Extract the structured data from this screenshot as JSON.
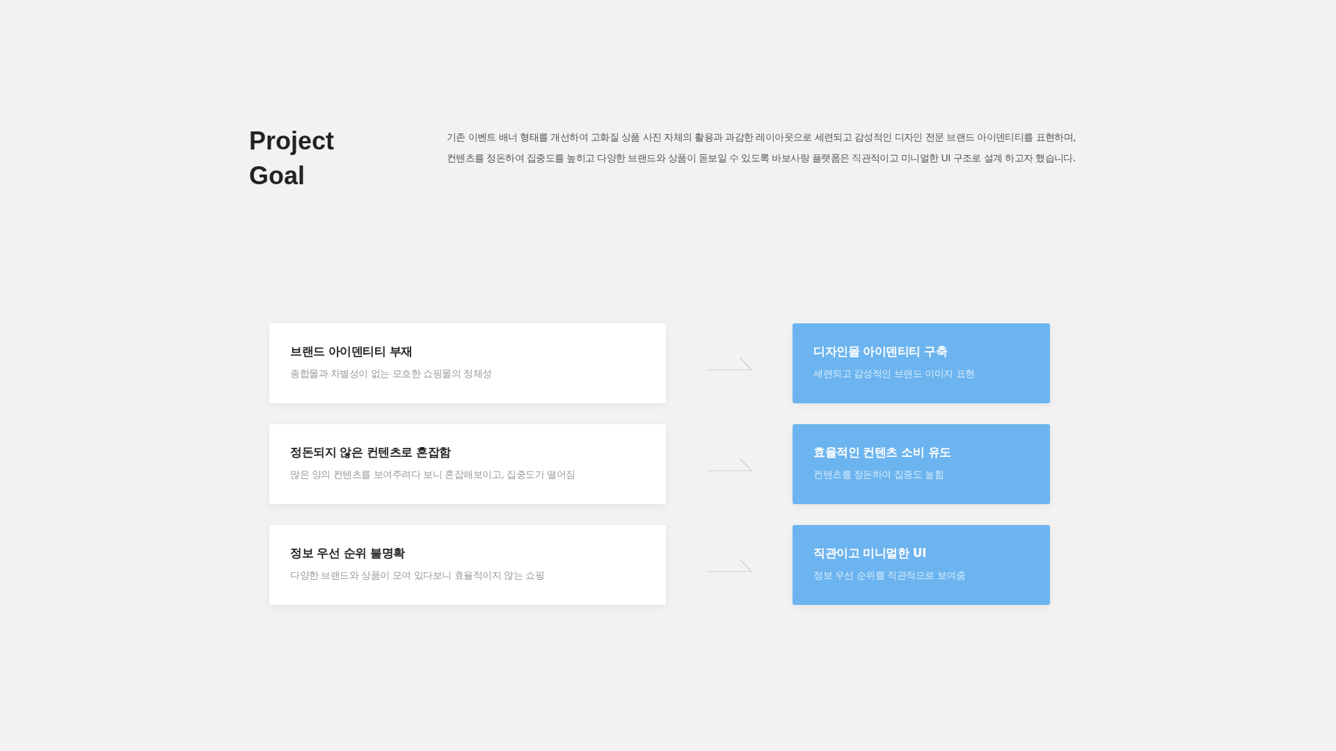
{
  "heading": {
    "lines": [
      "Project",
      "Goal"
    ]
  },
  "description": {
    "lines": [
      "기존 이벤트 배너 형태를 개선하여 고화질 상품 사진 자체의 활용과 과감한 레이아웃으로 세련되고 감성적인 디자인 전문 브랜드 아이덴티티를 표현하며,",
      "컨텐츠를 정돈하여 집중도를 높히고 다양한 브랜드와 상품이 돋보일 수 있도록 바보사랑 플랫폼은 직관적이고 미니멀한 UI 구조로 설계 하고자 했습니다."
    ]
  },
  "rows": [
    {
      "problem": {
        "title": "브랜드 아이덴티티 부재",
        "desc": "종합몰과 차별성이 없는 모호한 쇼핑몰의 정체성"
      },
      "solution": {
        "title": "디자인몰 아이덴티티 구축",
        "desc": "세련되고 감성적인 브랜드 이미지 표현"
      }
    },
    {
      "problem": {
        "title": "정돈되지 않은 컨텐츠로 혼잡함",
        "desc": "많은 양의 컨텐츠를 보여주려다 보니 혼잡해보이고, 집중도가 떨어짐"
      },
      "solution": {
        "title": "효율적인 컨텐츠 소비 유도",
        "desc": "컨텐츠를 정돈하여 집중도 높힘"
      }
    },
    {
      "problem": {
        "title": "정보 우선 순위 불명확",
        "desc": "다양한 브랜드와 상품이 모여 있다보니 효율적이지 않는 쇼핑"
      },
      "solution": {
        "title": "직관이고 미니멀한 UI",
        "desc": "정보 우선 순위를 직관적으로 보여줌"
      }
    }
  ]
}
